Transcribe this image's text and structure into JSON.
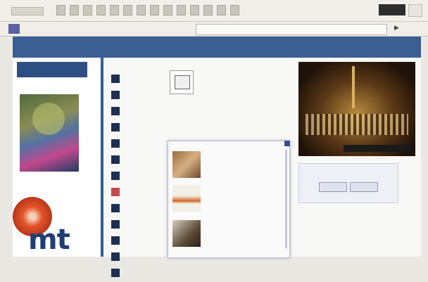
{
  "toolbar": {},
  "addressbar": {},
  "nav": {
    "row1": [],
    "row2": []
  },
  "left": {
    "logo_text": "",
    "brand": "mt"
  },
  "menu": {
    "items": [
      {
        "label": "",
        "icon": "square-icon"
      },
      {
        "label": "",
        "icon": "square-icon"
      },
      {
        "label": "",
        "icon": "square-icon"
      },
      {
        "label": "",
        "icon": "square-icon"
      },
      {
        "label": "",
        "icon": "square-icon"
      },
      {
        "label": "",
        "icon": "square-icon"
      },
      {
        "label": "",
        "icon": "square-icon"
      },
      {
        "label": "",
        "icon": "square-icon",
        "highlight": true
      },
      {
        "label": "",
        "icon": "square-icon"
      },
      {
        "label": "",
        "icon": "square-icon"
      },
      {
        "label": "",
        "icon": "square-icon"
      },
      {
        "label": "",
        "icon": "square-icon"
      },
      {
        "label": "",
        "icon": "square-icon"
      }
    ]
  },
  "middle": {},
  "popup": {
    "items": [
      {
        "text": ""
      },
      {
        "text": ""
      },
      {
        "text": ""
      }
    ]
  },
  "right": {
    "hero_banner": "",
    "info_title": "",
    "info_buttons": []
  },
  "colors": {
    "nav_blue": "#3c5f93",
    "accent_red": "#b23b3b",
    "logo_blue": "#1f3e74"
  }
}
